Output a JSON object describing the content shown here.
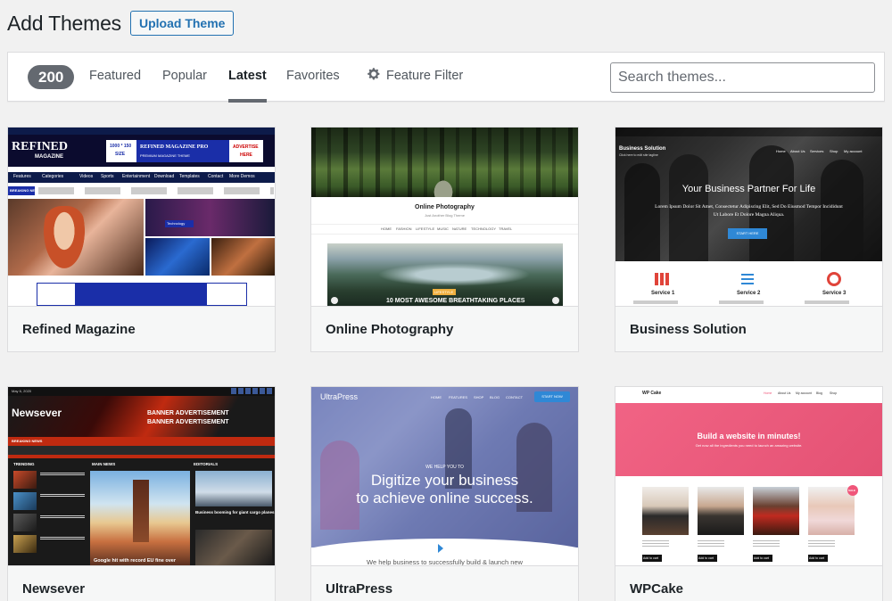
{
  "header": {
    "title": "Add Themes",
    "upload_label": "Upload Theme"
  },
  "filter": {
    "count": "200",
    "tabs": [
      {
        "label": "Featured"
      },
      {
        "label": "Popular"
      },
      {
        "label": "Latest",
        "active": true
      },
      {
        "label": "Favorites"
      }
    ],
    "feature_filter_label": "Feature Filter",
    "search_placeholder": "Search themes..."
  },
  "themes": [
    {
      "name": "Refined Magazine",
      "preview": {
        "logo_line1": "REFINED",
        "logo_line2": "MAGAZINE",
        "ad_size": "1000 * 150",
        "ad_size2": "SIZE",
        "ad_title": "REFINED MAGAZINE PRO",
        "ad_sub": "PREMIUM MAGAZINE THEME",
        "ad_cta1": "ADVERTISE",
        "ad_cta2": "HERE",
        "nav": [
          "Features",
          "Categories",
          "Videos",
          "Sports",
          "Entertainment",
          "Download",
          "Templates",
          "Contact",
          "More Demos"
        ],
        "breaking": "BREAKING NEWS",
        "tech_label": "Technology"
      }
    },
    {
      "name": "Online Photography",
      "preview": {
        "site_title": "Online Photography",
        "tagline": "Just Another Blog Theme",
        "nav": [
          "HOME",
          "FASHION",
          "LIFESTYLE",
          "MUSIC",
          "NATURE",
          "TECHNOLOGY",
          "TRAVEL"
        ],
        "post_tag": "LIFESTYLE",
        "post_title": "10 MOST AWESOME BREATHTAKING PLACES"
      }
    },
    {
      "name": "Business Solution",
      "preview": {
        "brand": "Business Solution",
        "brand_sub": "Click here to edit site tagline",
        "nav": [
          "Home",
          "About Us",
          "Services",
          "Shop",
          "My account"
        ],
        "headline": "Your Business Partner For Life",
        "lead1": "Lorem Ipsum Dolor Sit Amet, Consectetur Adipiscing Elit, Sed Do Eiusmod Tempor Incididunt",
        "lead2": "Ut Labore Et Dolore Magna Aliqua.",
        "cta": "START HERE",
        "services": [
          "Service 1",
          "Service 2",
          "Service 3"
        ]
      }
    },
    {
      "name": "Newsever",
      "preview": {
        "date": "May 6, 2020",
        "logo": "Newsever",
        "banner1": "BANNER ADVERTISEMENT",
        "banner2": "BANNER ADVERTISEMENT",
        "breaking": "BREAKING NEWS",
        "sections": [
          "TRENDING",
          "MAIN NEWS",
          "EDITORIALS"
        ],
        "main_caption": "Google hit with record EU fine over",
        "side_caption": "Business booming for giant cargo planes"
      }
    },
    {
      "name": "UltraPress",
      "preview": {
        "logo": "UltraPress",
        "nav": [
          "HOME",
          "FEATURES",
          "SHOP",
          "BLOG",
          "CONTACT"
        ],
        "cta": "START NOW",
        "kicker": "WE HELP YOU TO",
        "headline1": "Digitize your business",
        "headline2": "to achieve online success.",
        "footer_text": "We help business to successfully build & launch new"
      }
    },
    {
      "name": "WPCake",
      "preview": {
        "logo": "WP Cake",
        "nav": [
          "Home",
          "About Us",
          "My account",
          "Blog",
          "Shop"
        ],
        "hero_title": "Build a website in minutes!",
        "hero_sub": "Get now all the ingredients you need to launch an amazing website.",
        "add_to_cart": "Add to cart",
        "sale": "SALE"
      }
    }
  ],
  "colors": {
    "accent": "#2271b1",
    "badge": "#646970",
    "pink": "#f0567a",
    "blue_cta": "#2f88d6"
  }
}
